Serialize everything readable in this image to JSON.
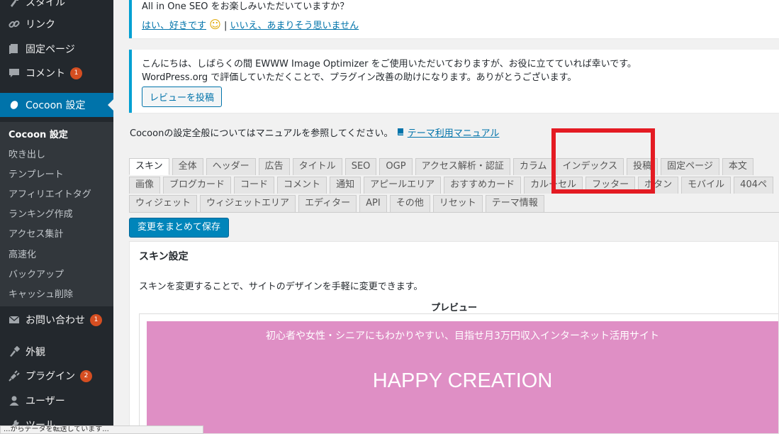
{
  "sidebar": {
    "items": [
      {
        "name": "styles",
        "label": "スタイル",
        "icon": "brush-icon"
      },
      {
        "name": "links",
        "label": "リンク",
        "icon": "link-icon"
      },
      {
        "name": "pages",
        "label": "固定ページ",
        "icon": "page-icon"
      },
      {
        "name": "comments",
        "label": "コメント",
        "icon": "comment-icon",
        "badge": "1"
      },
      {
        "name": "cocoon",
        "label": "Cocoon 設定",
        "icon": "cocoon-icon"
      },
      {
        "name": "contact",
        "label": "お問い合わせ",
        "icon": "mail-icon",
        "badge": "1"
      },
      {
        "name": "appearance",
        "label": "外観",
        "icon": "brush-icon"
      },
      {
        "name": "plugins",
        "label": "プラグイン",
        "icon": "plugin-icon",
        "badge": "2"
      },
      {
        "name": "users",
        "label": "ユーザー",
        "icon": "user-icon"
      },
      {
        "name": "tools",
        "label": "ツール",
        "icon": "wrench-icon"
      }
    ],
    "submenu": [
      "Cocoon 設定",
      "吹き出し",
      "テンプレート",
      "アフィリエイトタグ",
      "ランキング作成",
      "アクセス集計",
      "高速化",
      "バックアップ",
      "キャッシュ削除"
    ]
  },
  "notice1": {
    "question": "All in One SEO をお楽しみいただいていますか？",
    "yes": "はい、好きです",
    "smiley": "☺",
    "sep": "|",
    "no": "いいえ、あまりそう思いません"
  },
  "notice2": {
    "line1": "こんにちは、しばらくの間 EWWW Image Optimizer をご使用いただいておりますが、お役に立てていれば幸いです。",
    "line2": "WordPress.org で評価していただくことで、プラグイン改善の助けになります。ありがとうございます。",
    "button": "レビューを投稿"
  },
  "manual": {
    "text": "Cocoonの設定全般についてはマニュアルを参照してください。",
    "link": "テーマ利用マニュアル"
  },
  "tabs": {
    "row1": [
      "スキン",
      "全体",
      "ヘッダー",
      "広告",
      "タイトル",
      "SEO",
      "OGP",
      "アクセス解析・認証",
      "カラム",
      "インデックス",
      "投稿",
      "固定ページ",
      "本文"
    ],
    "row2": [
      "画像",
      "ブログカード",
      "コード",
      "コメント",
      "通知",
      "アピールエリア",
      "おすすめカード",
      "カルーセル",
      "フッター",
      "ボタン",
      "モバイル",
      "404ペ"
    ],
    "row3": [
      "ウィジェット",
      "ウィジェットエリア",
      "エディター",
      "API",
      "その他",
      "リセット",
      "テーマ情報"
    ],
    "active": "スキン"
  },
  "save_button": "変更をまとめて保存",
  "panel": {
    "title": "スキン設定",
    "description": "スキンを変更することで、サイトのデザインを手軽に変更できます。",
    "preview_label": "プレビュー",
    "tagline": "初心者や女性・シニアにもわかりやすい、目指せ月3万円収入インターネット活用サイト",
    "site_title": "HAPPY CREATION"
  },
  "statusbar": "...からデータを転送しています...",
  "colors": {
    "sidebar_bg": "#23282d",
    "accent": "#0073aa",
    "badge": "#d54e21",
    "highlight": "#e41b23",
    "preview_header": "#df8fc5"
  }
}
